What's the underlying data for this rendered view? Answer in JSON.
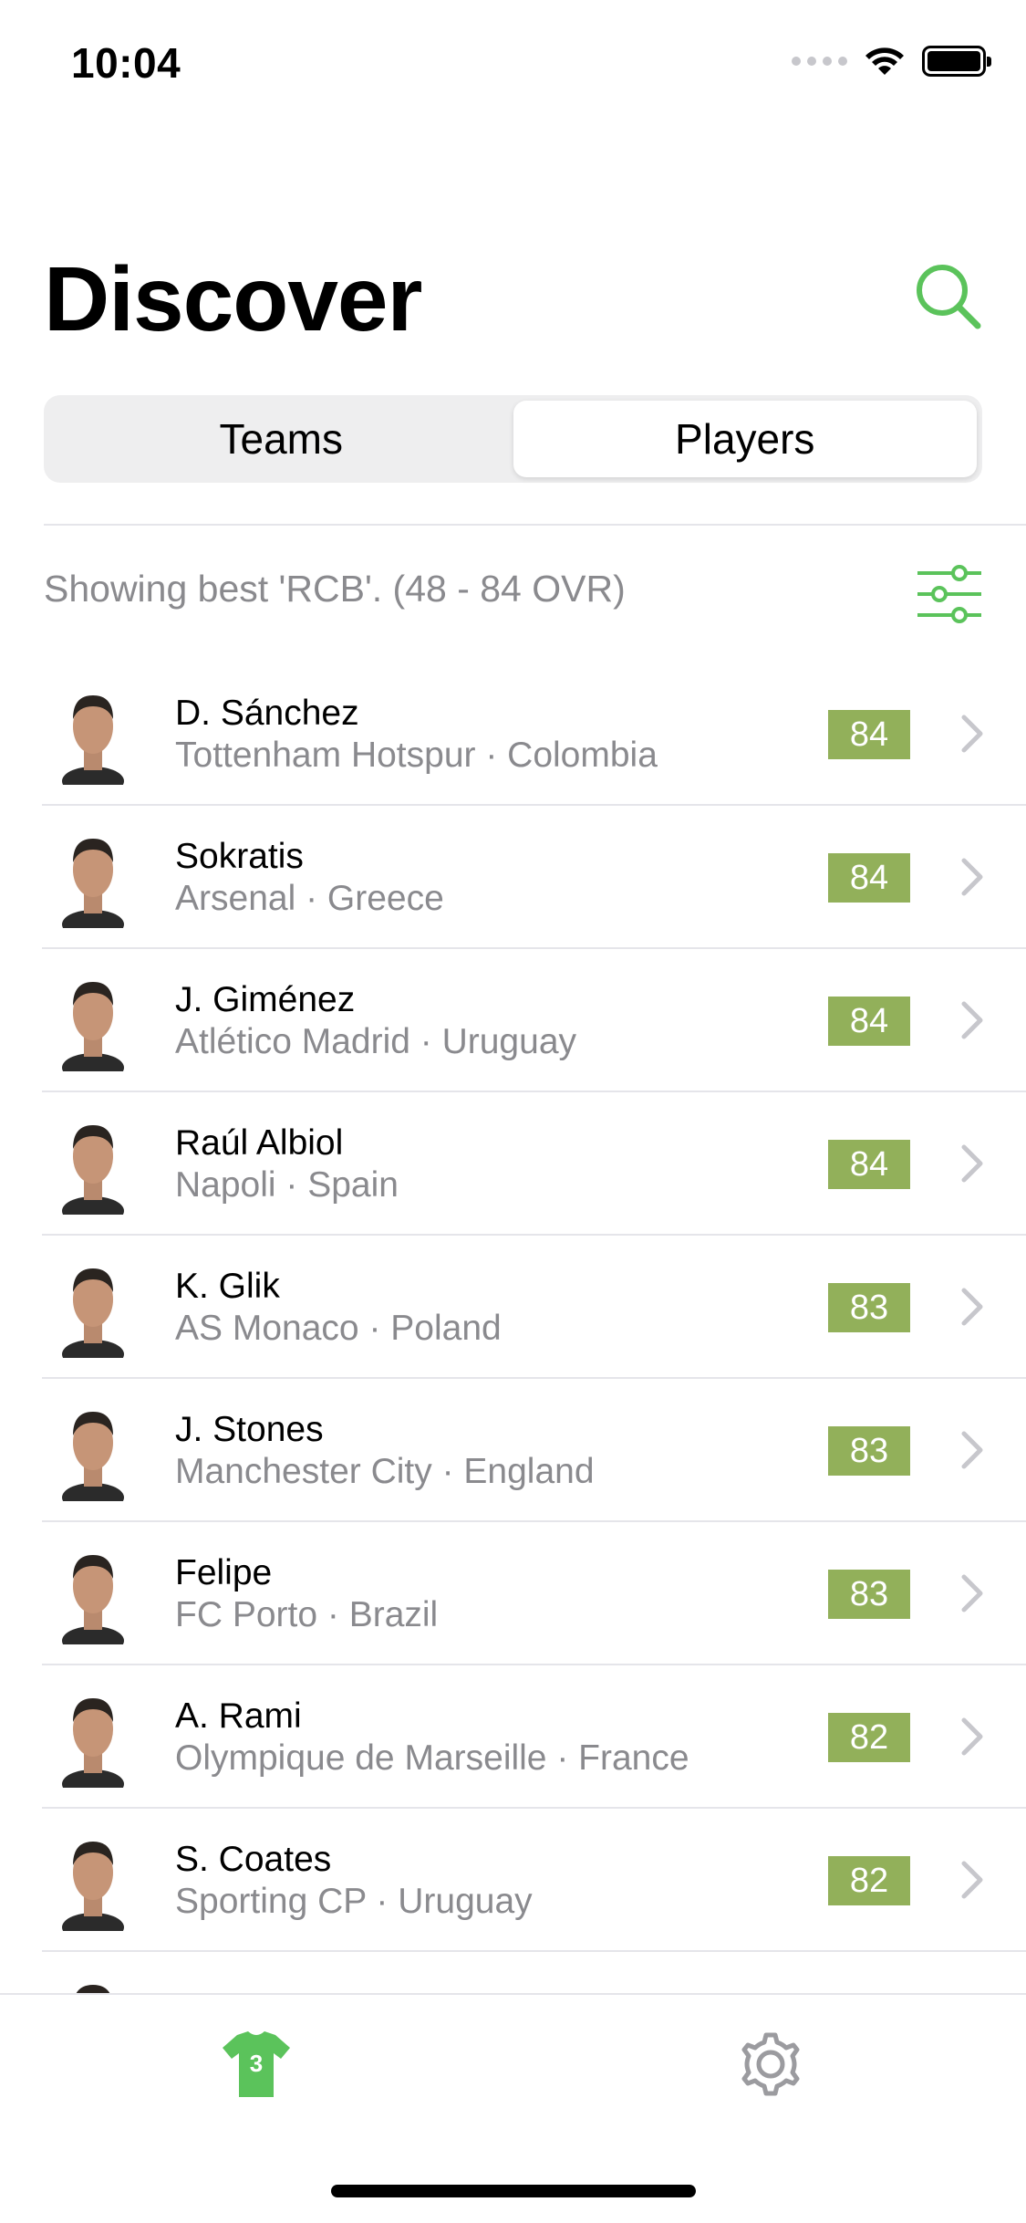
{
  "status_bar": {
    "time": "10:04"
  },
  "header": {
    "title": "Discover"
  },
  "segments": [
    {
      "label": "Teams",
      "active": false
    },
    {
      "label": "Players",
      "active": true
    }
  ],
  "filter": {
    "text": "Showing best 'RCB'. (48 - 84 OVR)"
  },
  "players": [
    {
      "name": "D. Sánchez",
      "team": "Tottenham Hotspur · Colombia",
      "rating": "84"
    },
    {
      "name": "Sokratis",
      "team": "Arsenal · Greece",
      "rating": "84"
    },
    {
      "name": "J. Giménez",
      "team": "Atlético Madrid · Uruguay",
      "rating": "84"
    },
    {
      "name": "Raúl Albiol",
      "team": "Napoli · Spain",
      "rating": "84"
    },
    {
      "name": "K. Glik",
      "team": "AS Monaco · Poland",
      "rating": "83"
    },
    {
      "name": "J. Stones",
      "team": "Manchester City · England",
      "rating": "83"
    },
    {
      "name": "Felipe",
      "team": "FC Porto · Brazil",
      "rating": "83"
    },
    {
      "name": "A. Rami",
      "team": "Olympique de Marseille · France",
      "rating": "82"
    },
    {
      "name": "S. Coates",
      "team": "Sporting CP · Uruguay",
      "rating": "82"
    }
  ],
  "tabbar": {
    "jersey_number": "3",
    "tabs": [
      {
        "icon": "jersey-icon",
        "active": true
      },
      {
        "icon": "gear-icon",
        "active": false
      }
    ]
  },
  "colors": {
    "accent": "#5bc35b",
    "rating_badge": "#92b05a",
    "secondary_text": "#8a8a8e",
    "separator": "#e5e5ea"
  }
}
